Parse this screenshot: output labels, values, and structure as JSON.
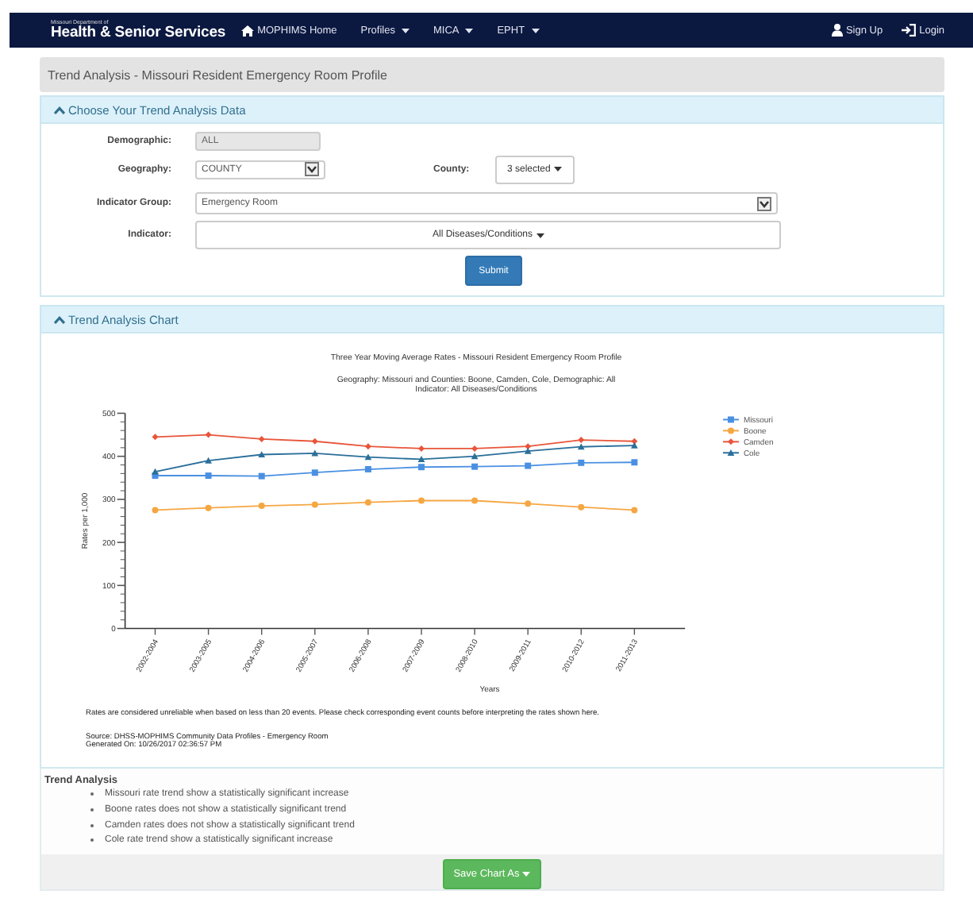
{
  "nav": {
    "brand_small": "Missouri Department of",
    "brand": "Health & Senior Services",
    "menu": [
      {
        "label": "MOPHIMS Home",
        "kind": "home"
      },
      {
        "label": "Profiles",
        "kind": "dropdown"
      },
      {
        "label": "MICA",
        "kind": "dropdown"
      },
      {
        "label": "EPHT",
        "kind": "dropdown"
      }
    ],
    "account": [
      {
        "label": "Sign Up",
        "kind": "user"
      },
      {
        "label": "Login",
        "kind": "login"
      }
    ]
  },
  "page_title": "Trend Analysis - Missouri Resident Emergency Room Profile",
  "data_panel": {
    "title": "Choose Your Trend Analysis Data",
    "expanded": true,
    "demographic": {
      "label": "Demographic:",
      "value": "ALL",
      "disabled": true
    },
    "geography": {
      "label": "Geography:",
      "value": "COUNTY"
    },
    "county": {
      "label": "County:",
      "value": "3 selected"
    },
    "indicator_group": {
      "label": "Indicator Group:",
      "value": "Emergency Room"
    },
    "indicator": {
      "label": "Indicator:",
      "value": "All Diseases/Conditions"
    },
    "submit": "Submit"
  },
  "chart_panel": {
    "title": "Trend Analysis Chart",
    "expanded": true,
    "chart_subtitle": [
      "Geography: Missouri and Counties: Boone, Camden, Cole, Demographic: All",
      "Indicator: All Diseases/Conditions"
    ],
    "chart_data": {
      "type": "line",
      "title": "Three Year Moving Average Rates - Missouri Resident Emergency Room Profile",
      "xlabel": "Years",
      "ylabel": "Rates per 1,000",
      "categories": [
        "2002-2004",
        "2003-2005",
        "2004-2006",
        "2005-2007",
        "2006-2008",
        "2007-2009",
        "2008-2010",
        "2009-2011",
        "2010-2012",
        "2011-2013"
      ],
      "legend": "right",
      "ylim": [
        0,
        500
      ],
      "yticks": [
        0,
        100,
        200,
        300,
        400,
        500
      ],
      "series": [
        {
          "name": "Missouri",
          "color": "#4a90e2",
          "marker": "square",
          "values": [
            355,
            355,
            354,
            362,
            370,
            375,
            376,
            378,
            385,
            386
          ]
        },
        {
          "name": "Boone",
          "color": "#f5a742",
          "marker": "circle",
          "values": [
            275,
            280,
            285,
            288,
            293,
            297,
            297,
            290,
            282,
            275
          ]
        },
        {
          "name": "Camden",
          "color": "#e8553a",
          "marker": "diamond",
          "values": [
            445,
            450,
            440,
            435,
            423,
            418,
            418,
            423,
            438,
            435
          ]
        },
        {
          "name": "Cole",
          "color": "#2a6f9a",
          "marker": "triangle",
          "values": [
            364,
            390,
            404,
            407,
            398,
            393,
            400,
            412,
            422,
            425
          ]
        }
      ]
    },
    "note": "Rates are considered unreliable when based on less than 20 events. Please check corresponding event counts before interpreting the rates shown here.",
    "source": "Source: DHSS-MOPHIMS Community Data Profiles - Emergency Room",
    "generated": "Generated On: 10/26/2017 02:36:57 PM"
  },
  "trend_analysis": {
    "title": "Trend Analysis",
    "items": [
      "Missouri rate trend show a statistically significant increase",
      "Boone rates does not show a statistically significant trend",
      "Camden rates does not show a statistically significant trend",
      "Cole rate trend show a statistically significant increase"
    ]
  },
  "save_button": "Save Chart As"
}
